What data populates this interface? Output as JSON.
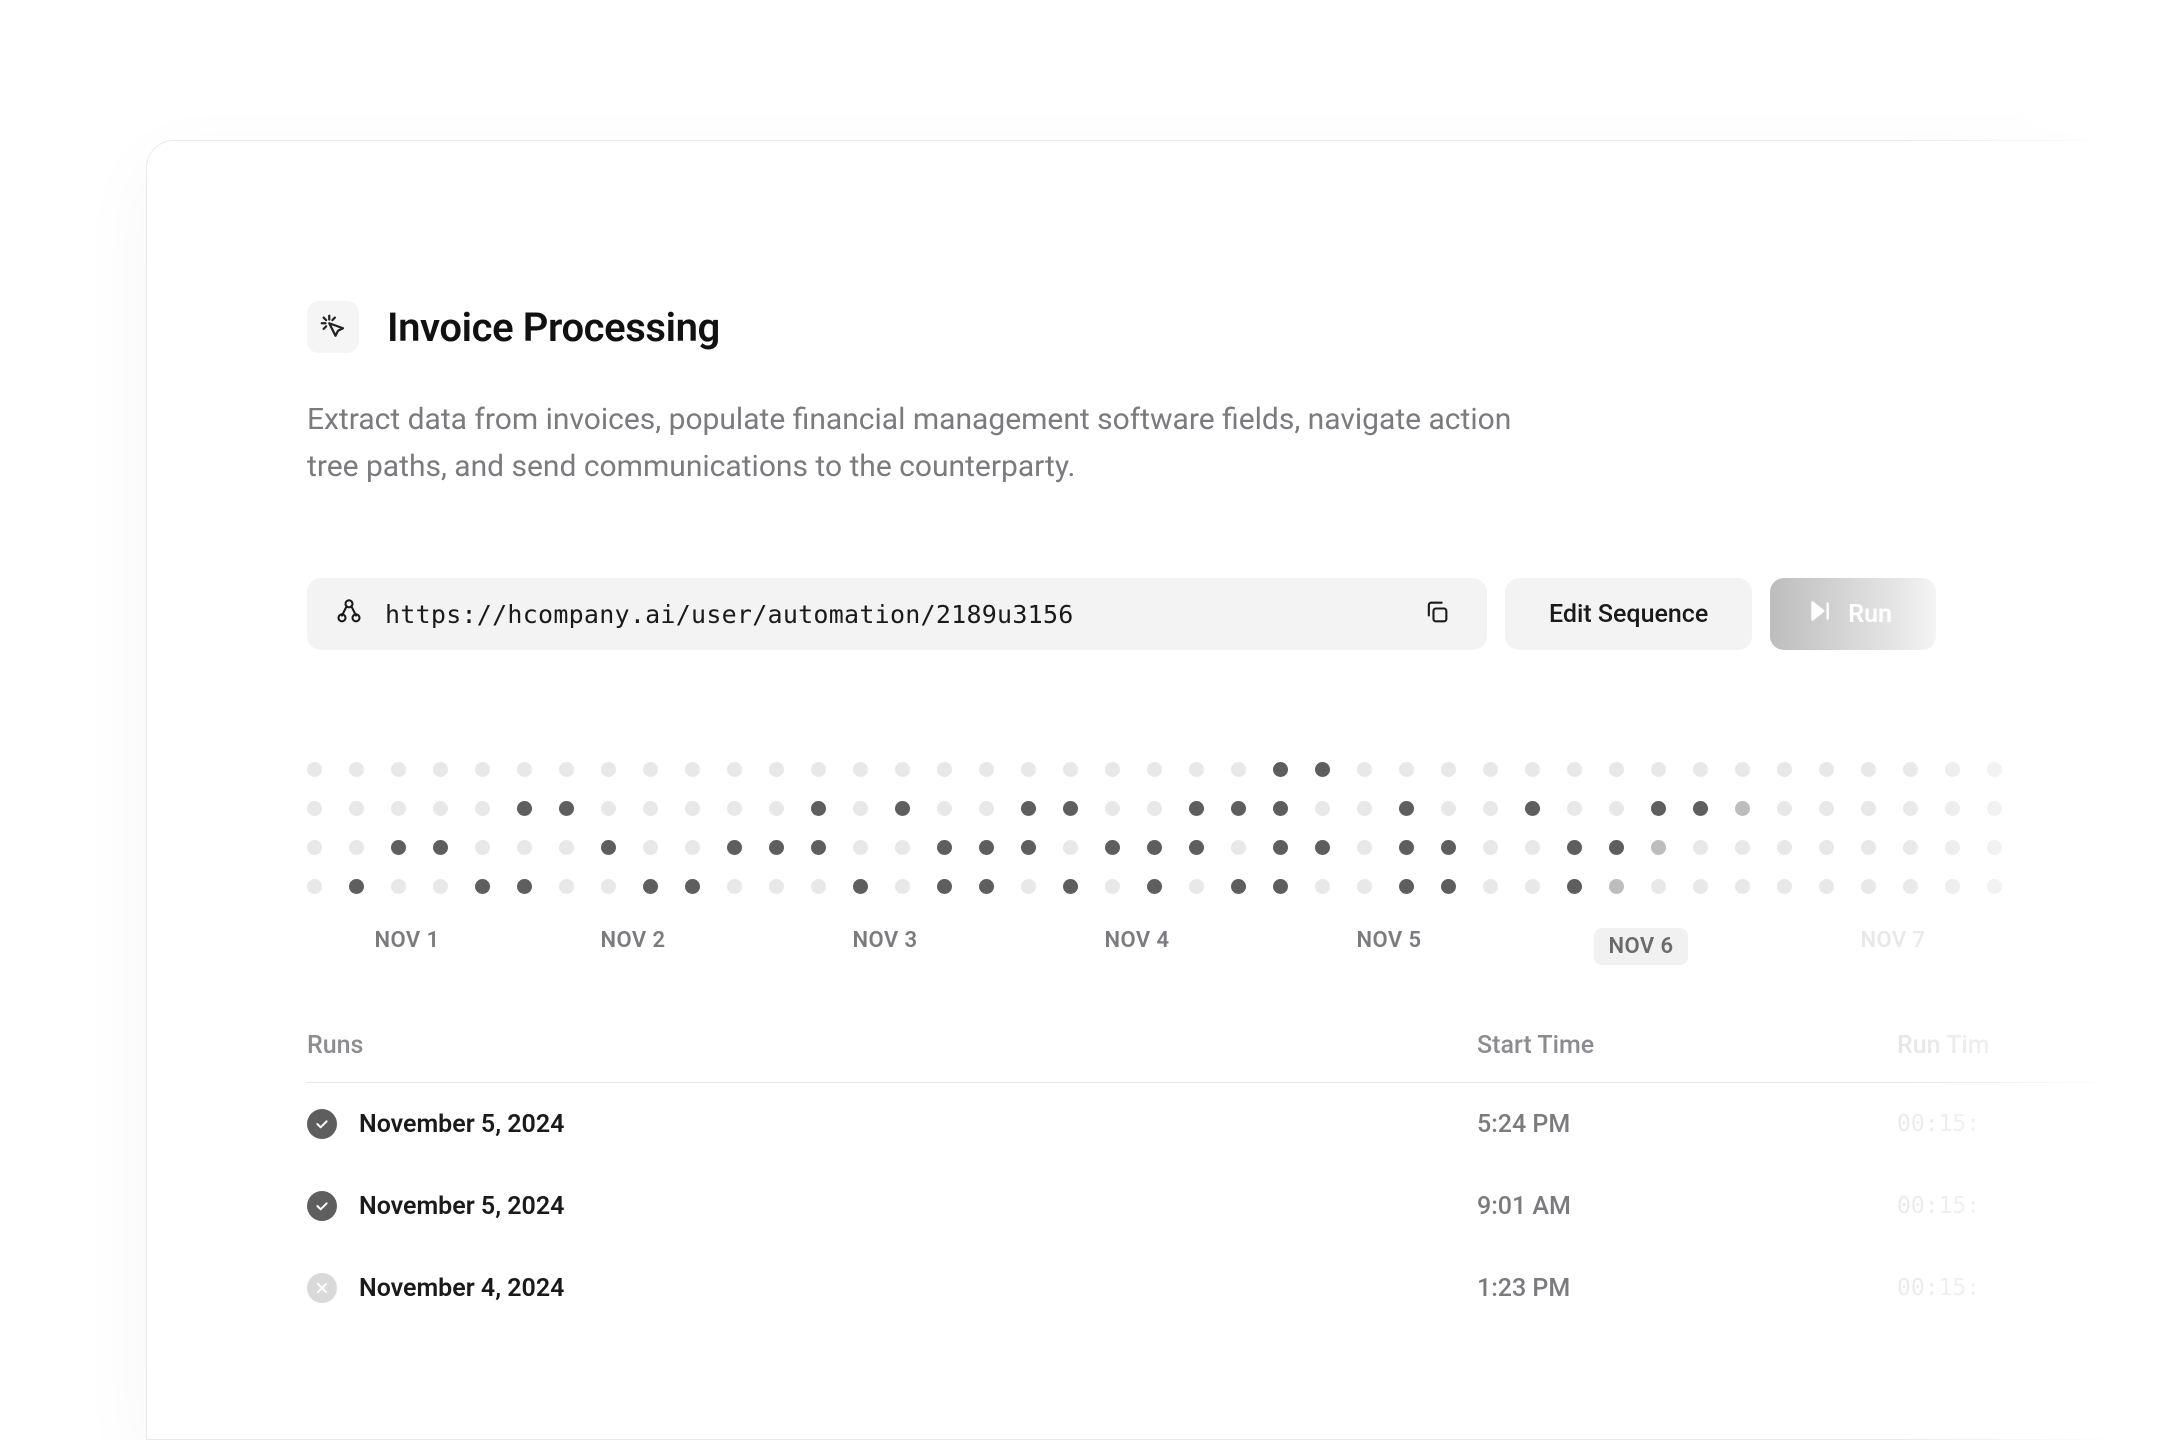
{
  "header": {
    "title": "Invoice Processing",
    "description": "Extract data from invoices, populate financial management software fields, navigate action tree paths, and send communications to the counterparty."
  },
  "url_bar": {
    "url": "https://hcompany.ai/user/automation/2189u3156"
  },
  "actions": {
    "edit_label": "Edit Sequence",
    "run_label": "Run"
  },
  "calendar": {
    "labels": [
      "NOV 1",
      "NOV 2",
      "NOV 3",
      "NOV 4",
      "NOV 5",
      "NOV 6",
      "NOV 7"
    ],
    "highlight_index": 5,
    "rows": [
      [
        0,
        0,
        0,
        0,
        0,
        0,
        0,
        0,
        0,
        0,
        0,
        0,
        0,
        0,
        0,
        0,
        0,
        0,
        0,
        0,
        0,
        0,
        0,
        1,
        1,
        0,
        0,
        0,
        0,
        0,
        0,
        0,
        0,
        0,
        0,
        0,
        0,
        0,
        0,
        0,
        0
      ],
      [
        0,
        0,
        0,
        0,
        0,
        1,
        1,
        0,
        0,
        0,
        0,
        0,
        1,
        0,
        1,
        0,
        0,
        1,
        1,
        0,
        0,
        1,
        1,
        1,
        0,
        0,
        1,
        0,
        0,
        1,
        0,
        0,
        1,
        1,
        2,
        0,
        0,
        0,
        0,
        0,
        0
      ],
      [
        0,
        0,
        1,
        1,
        0,
        0,
        0,
        1,
        0,
        0,
        1,
        1,
        1,
        0,
        0,
        1,
        1,
        1,
        0,
        1,
        1,
        1,
        0,
        1,
        1,
        0,
        1,
        1,
        0,
        0,
        1,
        1,
        2,
        0,
        0,
        0,
        0,
        0,
        0,
        0,
        0
      ],
      [
        0,
        1,
        0,
        0,
        1,
        1,
        0,
        0,
        1,
        1,
        0,
        0,
        0,
        1,
        0,
        1,
        1,
        0,
        1,
        0,
        1,
        0,
        1,
        1,
        0,
        0,
        1,
        1,
        0,
        0,
        1,
        2,
        0,
        0,
        0,
        0,
        0,
        0,
        0,
        0,
        0
      ]
    ]
  },
  "table": {
    "headers": {
      "runs": "Runs",
      "start": "Start Time",
      "runtime": "Run Tim"
    },
    "rows": [
      {
        "status": "success",
        "date": "November 5, 2024",
        "start": "5:24 PM",
        "runtime": "00:15:"
      },
      {
        "status": "success",
        "date": "November 5, 2024",
        "start": "9:01 AM",
        "runtime": "00:15:"
      },
      {
        "status": "fail",
        "date": "November 4, 2024",
        "start": "1:23 PM",
        "runtime": "00:15:"
      }
    ]
  }
}
